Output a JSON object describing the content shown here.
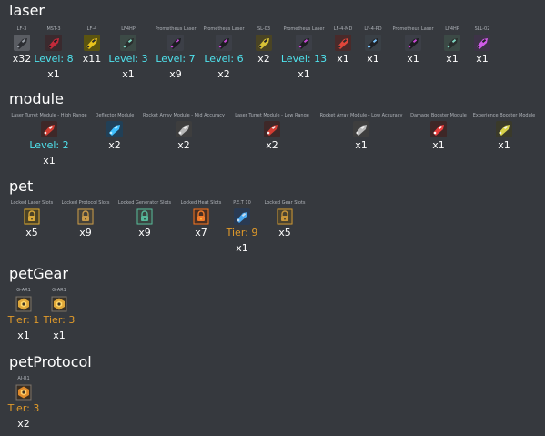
{
  "sections": {
    "laser": {
      "title": "laser"
    },
    "module": {
      "title": "module"
    },
    "pet": {
      "title": "pet"
    },
    "petGear": {
      "title": "petGear"
    },
    "petProtocol": {
      "title": "petProtocol"
    }
  },
  "laser": [
    {
      "name": "LF-3",
      "value": "x32",
      "sub": "",
      "icon": "laser-lf3-icon"
    },
    {
      "name": "MST-3",
      "value": "Level: 8",
      "sub": "x1",
      "icon": "laser-mst3-icon"
    },
    {
      "name": "LF-4",
      "value": "x11",
      "sub": "",
      "icon": "laser-lf4-icon"
    },
    {
      "name": "LF4HP",
      "value": "Level: 3",
      "sub": "x1",
      "icon": "laser-lf4hp-icon"
    },
    {
      "name": "Prometheus Laser",
      "value": "Level: 7",
      "sub": "x9",
      "icon": "prometheus-laser-icon"
    },
    {
      "name": "Prometheus Laser",
      "value": "Level: 6",
      "sub": "x2",
      "icon": "prometheus-laser-icon"
    },
    {
      "name": "SL-03",
      "value": "x2",
      "sub": "",
      "icon": "laser-sl03-icon"
    },
    {
      "name": "Prometheus Laser",
      "value": "Level: 13",
      "sub": "x1",
      "icon": "prometheus-laser-icon"
    },
    {
      "name": "LF-4-MD",
      "value": "x1",
      "sub": "",
      "icon": "laser-lf4md-icon"
    },
    {
      "name": "LF-4-PD",
      "value": "x1",
      "sub": "",
      "icon": "laser-lf4pd-icon"
    },
    {
      "name": "Prometheus Laser",
      "value": "x1",
      "sub": "",
      "icon": "prometheus-laser-icon"
    },
    {
      "name": "LF4HP",
      "value": "x1",
      "sub": "",
      "icon": "laser-lf4hp-icon"
    },
    {
      "name": "SLL-02",
      "value": "x1",
      "sub": "",
      "icon": "laser-sll02-icon"
    }
  ],
  "module": [
    {
      "name": "Laser Turret Module - High Range",
      "value": "Level: 2",
      "sub": "x1",
      "icon": "laser-turret-module-icon"
    },
    {
      "name": "Deflector Module",
      "value": "x2",
      "sub": "",
      "icon": "deflector-module-icon"
    },
    {
      "name": "Rocket Array Module - Mid Accuracy",
      "value": "x2",
      "sub": "",
      "icon": "rocket-array-module-icon"
    },
    {
      "name": "Laser Turret Module - Low Range",
      "value": "x2",
      "sub": "",
      "icon": "laser-turret-module-icon"
    },
    {
      "name": "Rocket Array Module - Low Accuracy",
      "value": "x1",
      "sub": "",
      "icon": "rocket-array-module-icon"
    },
    {
      "name": "Damage Booster Module",
      "value": "x1",
      "sub": "",
      "icon": "damage-booster-module-icon"
    },
    {
      "name": "Experience Booster Module",
      "value": "x1",
      "sub": "",
      "icon": "experience-booster-module-icon"
    }
  ],
  "pet": [
    {
      "name": "Locked Laser Slots",
      "value": "x5",
      "sub": "",
      "icon": "locked-laser-slot-icon"
    },
    {
      "name": "Locked Protocol Slots",
      "value": "x9",
      "sub": "",
      "icon": "locked-protocol-slot-icon"
    },
    {
      "name": "Locked Generator Slots",
      "value": "x9",
      "sub": "",
      "icon": "locked-generator-slot-icon"
    },
    {
      "name": "Locked Heat Slots",
      "value": "x7",
      "sub": "",
      "icon": "locked-heat-slot-icon"
    },
    {
      "name": "P.E.T 10",
      "value": "Tier: 9",
      "sub": "x1",
      "icon": "pet10-icon"
    },
    {
      "name": "Locked Gear Slots",
      "value": "x5",
      "sub": "",
      "icon": "locked-gear-slot-icon"
    }
  ],
  "petGear": [
    {
      "name": "G-AR1",
      "value": "Tier: 1",
      "sub": "x1",
      "icon": "pet-gear-gar1-icon"
    },
    {
      "name": "G-AR1",
      "value": "Tier: 3",
      "sub": "x1",
      "icon": "pet-gear-gar1-icon"
    }
  ],
  "petProtocol": [
    {
      "name": "AI-R1",
      "value": "Tier: 3",
      "sub": "x2",
      "icon": "pet-protocol-air1-icon"
    }
  ],
  "colors": {
    "background": "#36393e",
    "level": "#4fe3ee",
    "tier": "#e09a2a",
    "count": "#ffffff",
    "name": "#aeb2b8"
  }
}
